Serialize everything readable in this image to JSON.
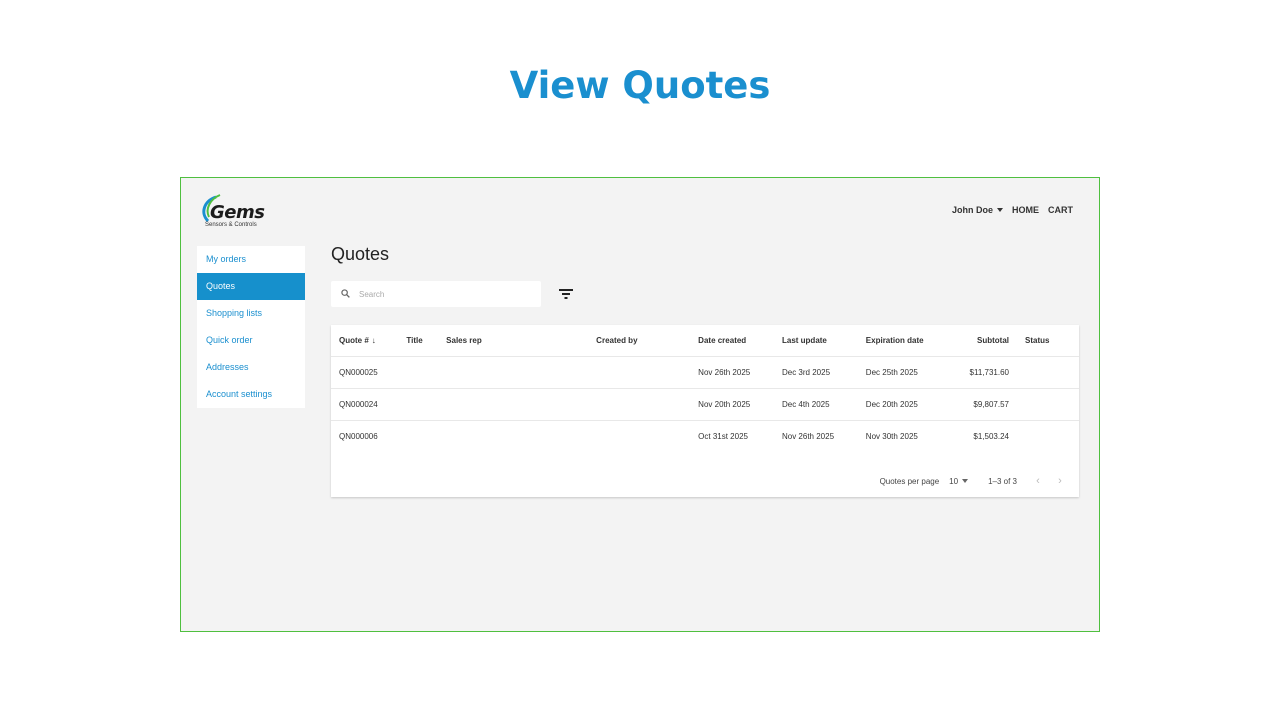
{
  "slide": {
    "title": "View Quotes"
  },
  "brand": {
    "name": "Gems",
    "tagline": "Sensors & Controls",
    "accent": "#1a8fcf"
  },
  "header": {
    "user": "John Doe",
    "home": "HOME",
    "cart": "CART"
  },
  "sidebar": {
    "items": [
      {
        "label": "My orders",
        "active": false
      },
      {
        "label": "Quotes",
        "active": true
      },
      {
        "label": "Shopping lists",
        "active": false
      },
      {
        "label": "Quick order",
        "active": false
      },
      {
        "label": "Addresses",
        "active": false
      },
      {
        "label": "Account settings",
        "active": false
      }
    ]
  },
  "main": {
    "title": "Quotes",
    "search": {
      "placeholder": "Search",
      "icon": "search-icon"
    },
    "filter": {
      "icon": "filter-icon"
    }
  },
  "table": {
    "columns": [
      "Quote #",
      "Title",
      "Sales rep",
      "Created by",
      "Date created",
      "Last update",
      "Expiration date",
      "Subtotal",
      "Status"
    ],
    "rows": [
      [
        "QN000025",
        "",
        "",
        "",
        "Nov 26th 2025",
        "Dec 3rd 2025",
        "Dec 25th 2025",
        "$11,731.60",
        ""
      ],
      [
        "QN000024",
        "",
        "",
        "",
        "Nov 20th 2025",
        "Dec 4th 2025",
        "Dec 20th 2025",
        "$9,807.57",
        ""
      ],
      [
        "QN000006",
        "",
        "",
        "",
        "Oct 31st 2025",
        "Nov 26th 2025",
        "Nov 30th 2025",
        "$1,503.24",
        ""
      ]
    ]
  },
  "pagination": {
    "label": "Quotes per page",
    "per_page": "10",
    "range": "1–3 of 3"
  }
}
